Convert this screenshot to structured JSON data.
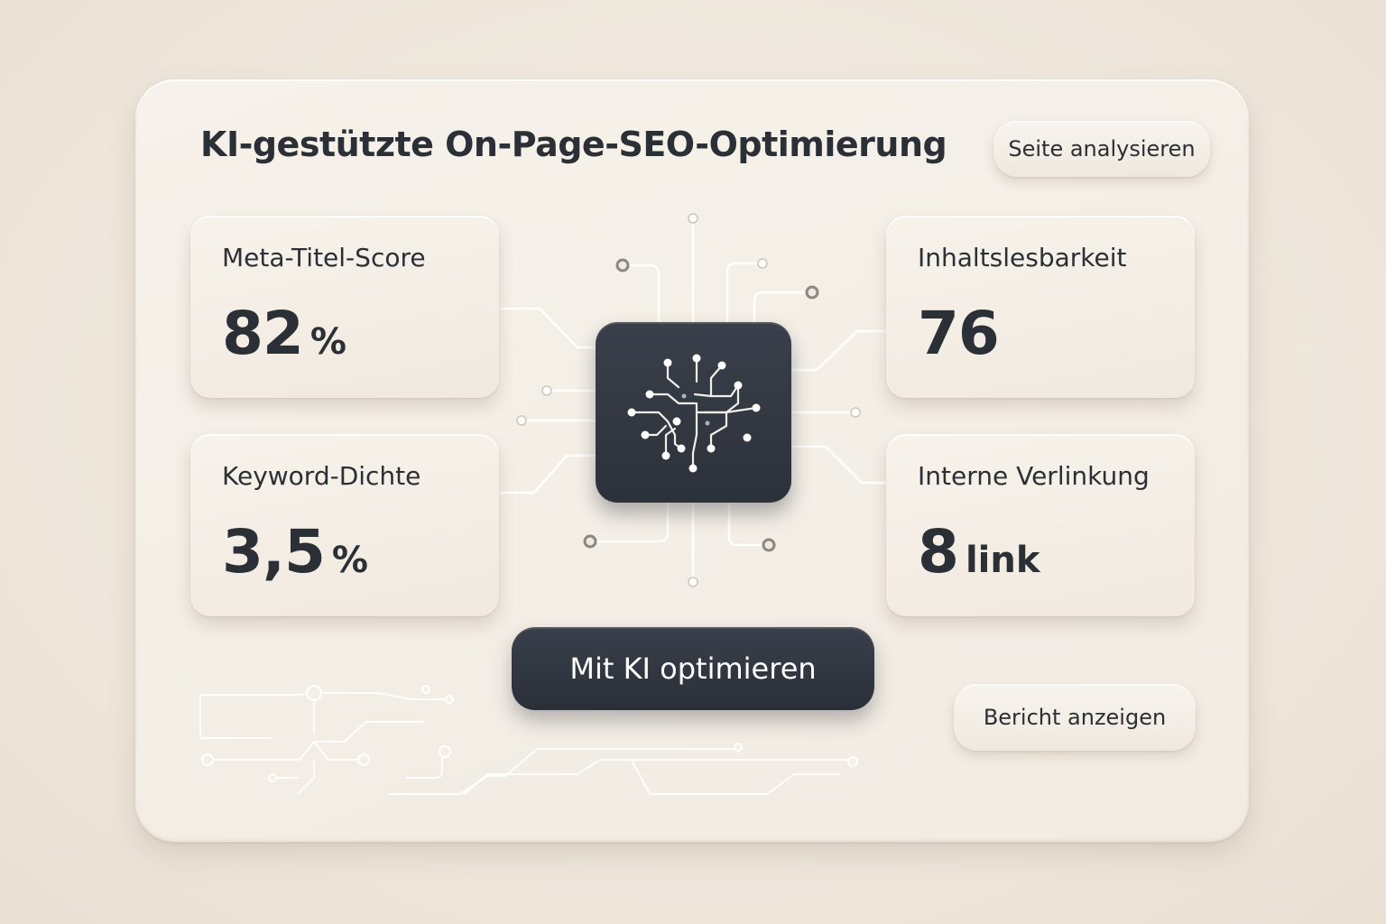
{
  "header": {
    "title": "KI-gestützte On-Page-SEO-Optimierung",
    "analyze_button": "Seite analysieren"
  },
  "metrics": [
    {
      "label": "Meta-Titel-Score",
      "value": "82",
      "unit": "%"
    },
    {
      "label": "Keyword-Dichte",
      "value": "3,5",
      "unit": "%"
    },
    {
      "label": "Inhaltslesbarkeit",
      "value": "76",
      "unit": ""
    },
    {
      "label": "Interne Verlinkung",
      "value": "8",
      "unit": "link"
    }
  ],
  "center": {
    "icon": "ai-brain-circuit-icon"
  },
  "actions": {
    "optimize_button": "Mit KI optimieren",
    "report_button": "Bericht anzeigen"
  },
  "colors": {
    "background": "#efe8de",
    "panel": "#f4eee6",
    "dark": "#2f343d",
    "text": "#2b2f36"
  }
}
